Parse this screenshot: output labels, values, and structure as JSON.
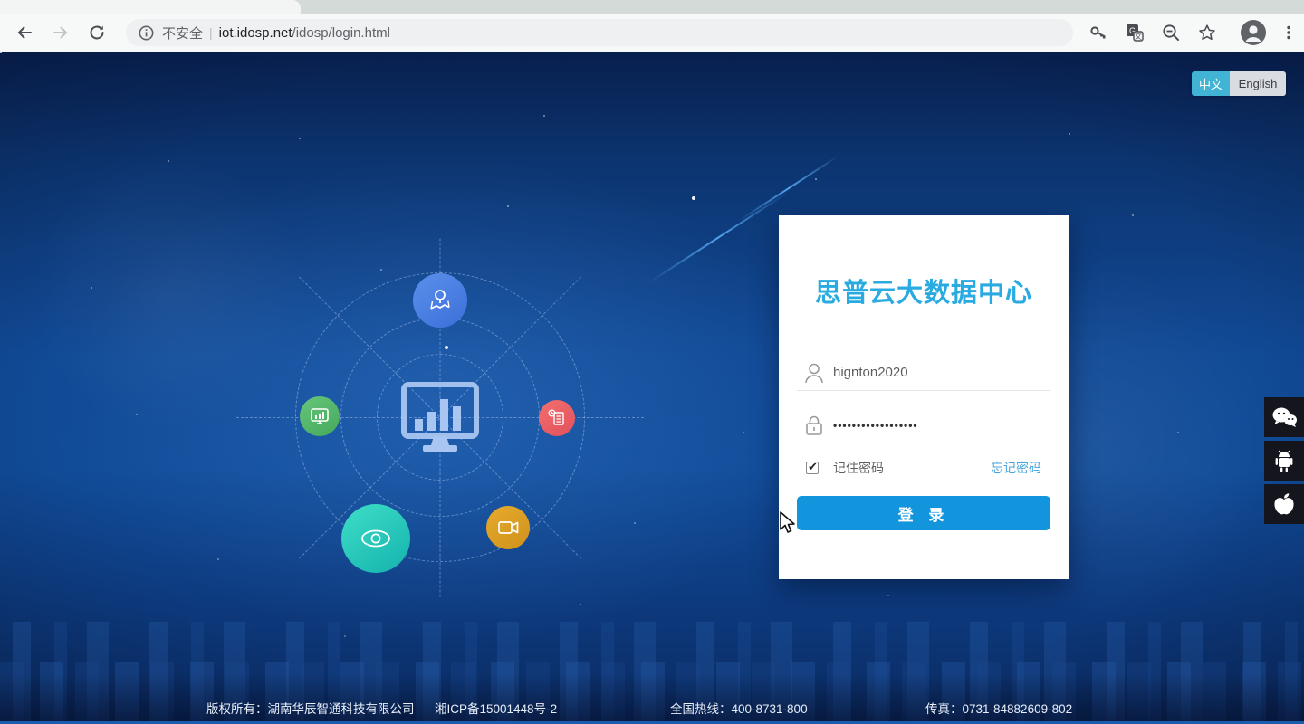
{
  "browser": {
    "security_label": "不安全",
    "separator": "|",
    "url_host": "iot.idosp.net",
    "url_path": "/idosp/login.html"
  },
  "language_toggle": {
    "chinese": "中文",
    "english": "English"
  },
  "login": {
    "title": "思普云大数据中心",
    "username_value": "hignton2020",
    "password_masked": "••••••••••••••••••",
    "checkbox_checked": "✔",
    "remember_label": "记住密码",
    "forgot_label": "忘记密码",
    "login_button": "登 录"
  },
  "hub_icons": {
    "center": "dashboard-monitor",
    "top": "map-location",
    "left": "device-monitor",
    "right": "report-document",
    "bottom_left": "eye-monitoring",
    "bottom_right": "video-camera"
  },
  "footer": {
    "copyright": "版权所有：湖南华辰智通科技有限公司",
    "icp": "湘ICP备15001448号-2",
    "hotline": "全国热线：400-8731-800",
    "fax": "传真：0731-84882609-802"
  },
  "colors": {
    "accent_title": "#29abe2",
    "login_button": "#1295dc",
    "lang_active": "#41b4d6",
    "page_top": "#081f4e",
    "page_mid": "#114c99",
    "satellite_blue": "#4a82e6",
    "satellite_green": "#58bb6c",
    "satellite_red": "#ee5f67",
    "satellite_teal": "#2ed2be",
    "satellite_orange": "#dd9d23"
  }
}
